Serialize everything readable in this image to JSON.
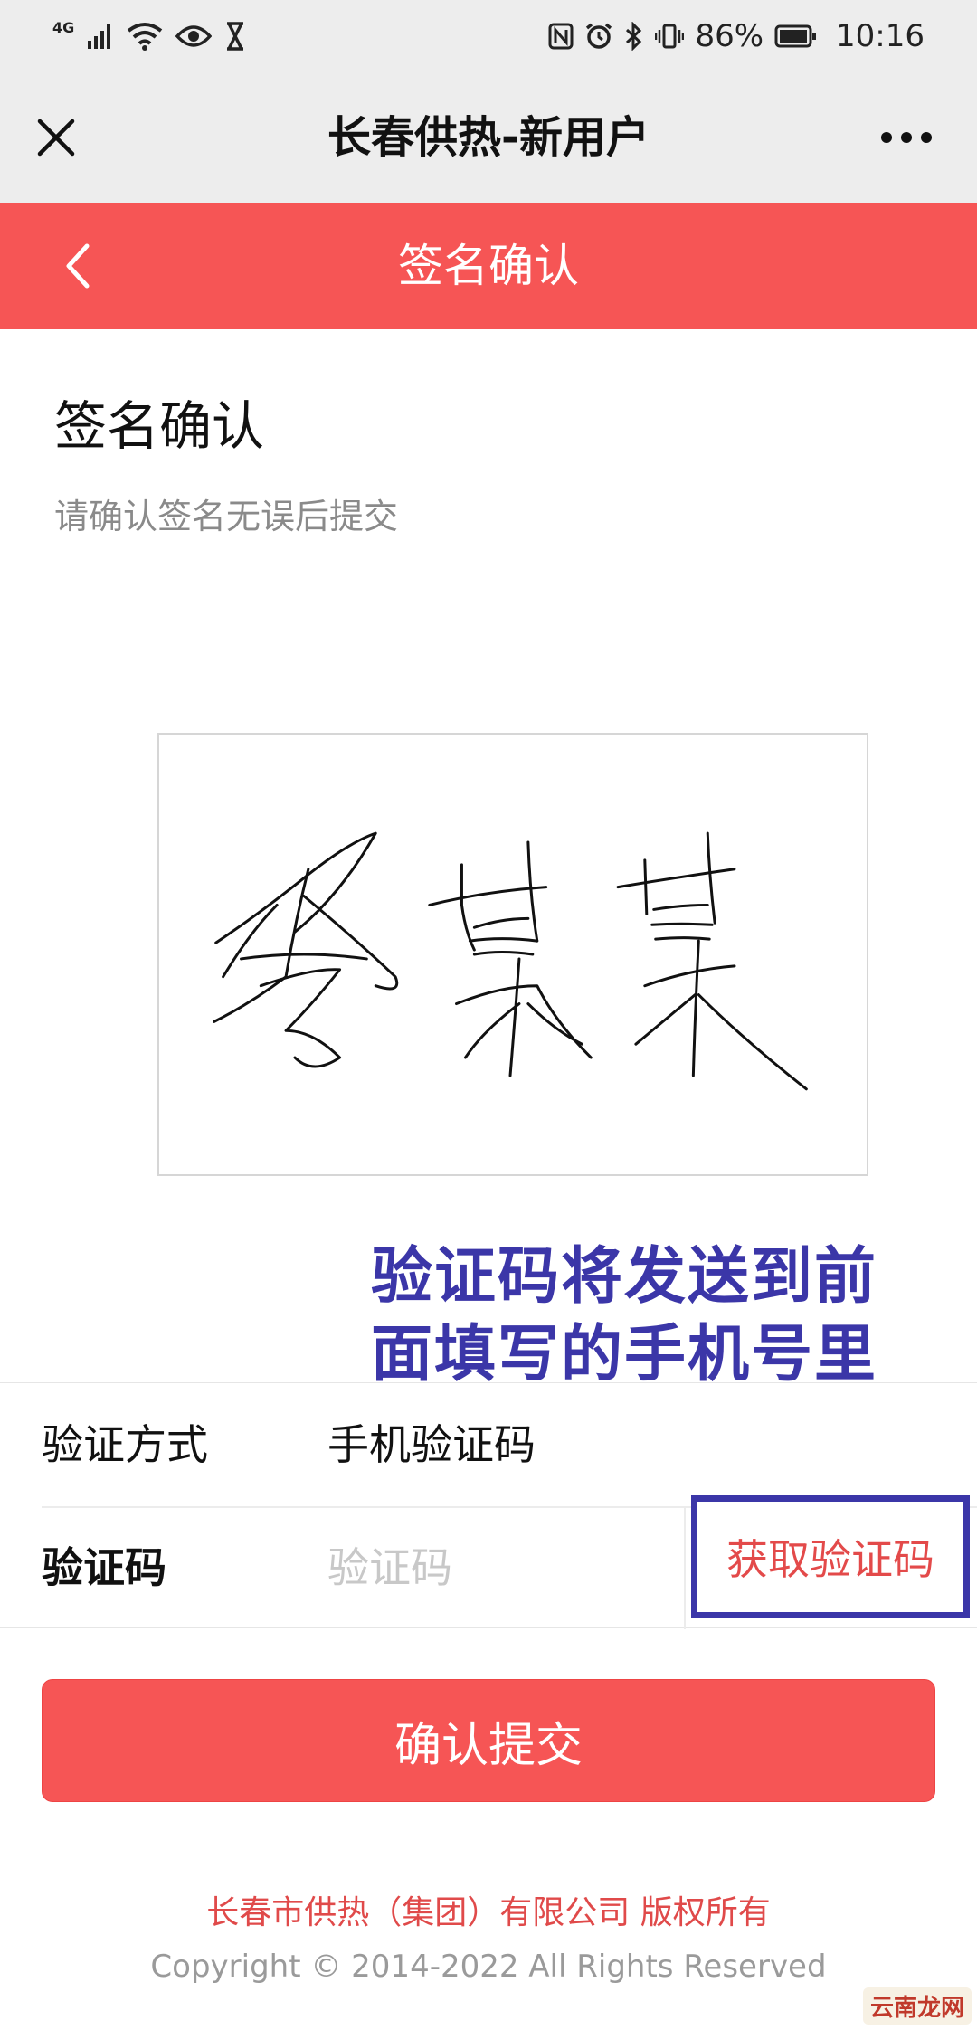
{
  "status_bar": {
    "network": "4G",
    "battery": "86%",
    "time": "10:16"
  },
  "title_bar": {
    "title": "长春供热-新用户"
  },
  "header": {
    "title": "签名确认"
  },
  "page": {
    "heading": "签名确认",
    "subheading": "请确认签名无误后提交"
  },
  "annotation": {
    "line1": "验证码将发送到前",
    "line2": "面填写的手机号里"
  },
  "form": {
    "method_label": "验证方式",
    "method_value": "手机验证码",
    "code_label": "验证码",
    "code_value": "",
    "code_placeholder": "验证码",
    "get_code_label": "获取验证码"
  },
  "submit": {
    "label": "确认提交"
  },
  "footer": {
    "company": "长春市供热（集团）有限公司 版权所有",
    "copyright": "Copyright © 2014-2022 All Rights Reserved"
  },
  "watermark": {
    "text": "云南龙网"
  },
  "colors": {
    "brand_red": "#f65555",
    "annotation_blue": "#3b36a8",
    "link_red": "#e34a4a"
  },
  "icons": {
    "close": "close-icon",
    "more": "more-dots-icon",
    "back": "chevron-left-icon"
  }
}
